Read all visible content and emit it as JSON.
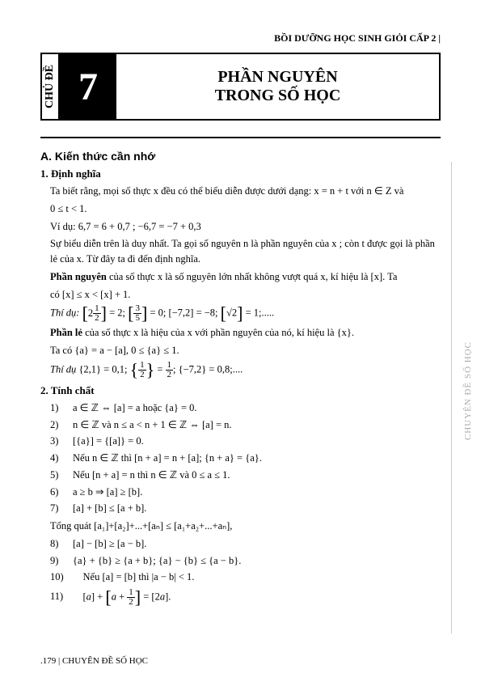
{
  "header": "BỒI DƯỠNG HỌC SINH GIỎI CẤP 2 |",
  "chude": "CHỦ ĐỀ",
  "chapter_num": "7",
  "title1": "PHẦN NGUYÊN",
  "title2": "TRONG SỐ HỌC",
  "secA": "A. Kiến thức cần nhớ",
  "sub1": "1. Định nghĩa",
  "p1": "Ta biết rằng, mọi số thực x đều có thể biểu diễn được dưới dạng: x = n + t với n ∈ Z và",
  "p1b": "0 ≤ t < 1.",
  "p2": "Ví dụ: 6,7 = 6 + 0,7 ; −6,7 = −7 + 0,3",
  "p3": "Sự biểu diễn trên là duy nhất. Ta gọi số nguyên n là phần nguyên của x ; còn t được gọi là phần lẻ của x. Từ đây ta đi đến định nghĩa.",
  "p4a": "Phần nguyên",
  "p4b": " của số thực x là số nguyên lớn nhất không vượt quá x, kí hiệu là [x]. Ta",
  "p5": "có [x] ≤ x < [x] + 1.",
  "p6lbl": "Thí dụ:",
  "p6": " [2½] = 2; [3/5] = 0; [−7,2] = −8; [√2] = 1; .....",
  "p7a": "Phần lẻ",
  "p7b": " của số thực x là hiệu của x với phần nguyên của nó, kí hiệu là {x}.",
  "p8": "Ta có {a} = a − [a], 0 ≤ {a} ≤ 1.",
  "p9lbl": "Thí dụ",
  "p9": " {2,1} = 0,1; {½} = ½; {−7,2} = 0,8; ....",
  "sub2": "2. Tính chất",
  "props": [
    "a ∈ ℤ ⇔ [a] = a hoặc {a} = 0.",
    "n ∈ ℤ và n ≤ a < n + 1 ∈ ℤ ⇔ [a] = n.",
    "[{a}] = {[a]} = 0.",
    "Nếu n ∈ ℤ thì [n + a] = n + [a]; {n + a} = {a}.",
    "Nếu [n + a] = n thì n ∈ ℤ và 0 ≤ a ≤ 1.",
    "a ≥ b ⇒ [a] ≥ [b].",
    "[a] + [b] ≤ [a + b]."
  ],
  "tongquat": "Tổng quát [a₁]+[a₂]+...+[aₙ] ≤ [a₁+a₂+...+aₙ],",
  "props2": [
    "[a] − [b] ≥ [a − b].",
    "{a} + {b} ≥ {a + b}; {a} − {b} ≤ {a − b}.",
    "Nếu [a] = [b] thì |a − b| < 1.",
    "[a] + [a + ½] = [2a]."
  ],
  "footer": ".179 | CHUYÊN ĐỀ SỐ HỌC",
  "side": "CHUYÊN ĐỀ SỐ HỌC"
}
